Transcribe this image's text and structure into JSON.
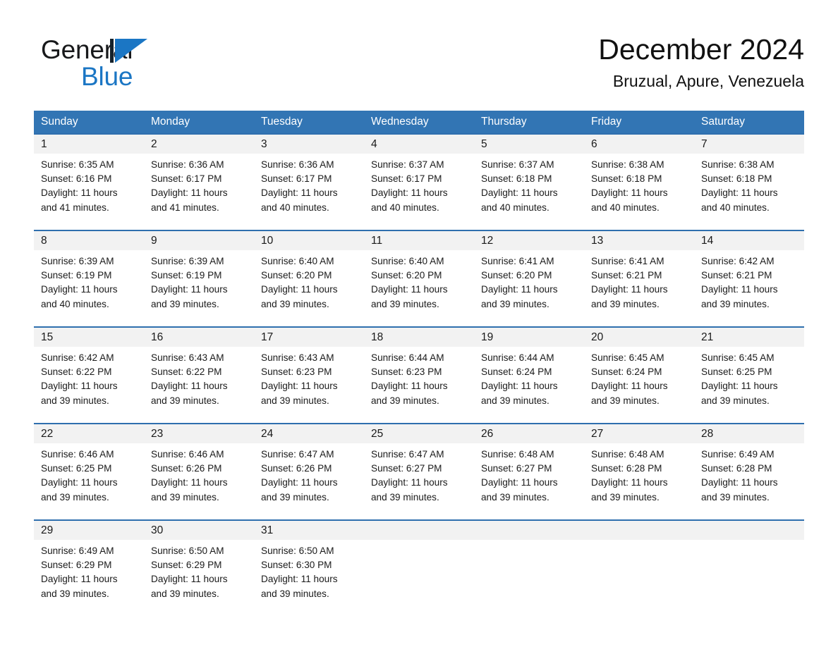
{
  "brand": {
    "word1": "General",
    "word2": "Blue",
    "mark_icon": "blue-triangle-logo-icon"
  },
  "header": {
    "title": "December 2024",
    "subtitle": "Bruzual, Apure, Venezuela"
  },
  "colors": {
    "header_blue": "#3275b4",
    "rule_blue": "#2f6fae",
    "daynum_band": "#f2f2f2",
    "brand_blue": "#1b76c4",
    "text": "#1a1a1a",
    "page_background": "#ffffff"
  },
  "weekdays": [
    "Sunday",
    "Monday",
    "Tuesday",
    "Wednesday",
    "Thursday",
    "Friday",
    "Saturday"
  ],
  "weeks": [
    {
      "days": [
        {
          "num": "1",
          "sunrise": "Sunrise: 6:35 AM",
          "sunset": "Sunset: 6:16 PM",
          "daylight1": "Daylight: 11 hours",
          "daylight2": "and 41 minutes."
        },
        {
          "num": "2",
          "sunrise": "Sunrise: 6:36 AM",
          "sunset": "Sunset: 6:17 PM",
          "daylight1": "Daylight: 11 hours",
          "daylight2": "and 41 minutes."
        },
        {
          "num": "3",
          "sunrise": "Sunrise: 6:36 AM",
          "sunset": "Sunset: 6:17 PM",
          "daylight1": "Daylight: 11 hours",
          "daylight2": "and 40 minutes."
        },
        {
          "num": "4",
          "sunrise": "Sunrise: 6:37 AM",
          "sunset": "Sunset: 6:17 PM",
          "daylight1": "Daylight: 11 hours",
          "daylight2": "and 40 minutes."
        },
        {
          "num": "5",
          "sunrise": "Sunrise: 6:37 AM",
          "sunset": "Sunset: 6:18 PM",
          "daylight1": "Daylight: 11 hours",
          "daylight2": "and 40 minutes."
        },
        {
          "num": "6",
          "sunrise": "Sunrise: 6:38 AM",
          "sunset": "Sunset: 6:18 PM",
          "daylight1": "Daylight: 11 hours",
          "daylight2": "and 40 minutes."
        },
        {
          "num": "7",
          "sunrise": "Sunrise: 6:38 AM",
          "sunset": "Sunset: 6:18 PM",
          "daylight1": "Daylight: 11 hours",
          "daylight2": "and 40 minutes."
        }
      ]
    },
    {
      "days": [
        {
          "num": "8",
          "sunrise": "Sunrise: 6:39 AM",
          "sunset": "Sunset: 6:19 PM",
          "daylight1": "Daylight: 11 hours",
          "daylight2": "and 40 minutes."
        },
        {
          "num": "9",
          "sunrise": "Sunrise: 6:39 AM",
          "sunset": "Sunset: 6:19 PM",
          "daylight1": "Daylight: 11 hours",
          "daylight2": "and 39 minutes."
        },
        {
          "num": "10",
          "sunrise": "Sunrise: 6:40 AM",
          "sunset": "Sunset: 6:20 PM",
          "daylight1": "Daylight: 11 hours",
          "daylight2": "and 39 minutes."
        },
        {
          "num": "11",
          "sunrise": "Sunrise: 6:40 AM",
          "sunset": "Sunset: 6:20 PM",
          "daylight1": "Daylight: 11 hours",
          "daylight2": "and 39 minutes."
        },
        {
          "num": "12",
          "sunrise": "Sunrise: 6:41 AM",
          "sunset": "Sunset: 6:20 PM",
          "daylight1": "Daylight: 11 hours",
          "daylight2": "and 39 minutes."
        },
        {
          "num": "13",
          "sunrise": "Sunrise: 6:41 AM",
          "sunset": "Sunset: 6:21 PM",
          "daylight1": "Daylight: 11 hours",
          "daylight2": "and 39 minutes."
        },
        {
          "num": "14",
          "sunrise": "Sunrise: 6:42 AM",
          "sunset": "Sunset: 6:21 PM",
          "daylight1": "Daylight: 11 hours",
          "daylight2": "and 39 minutes."
        }
      ]
    },
    {
      "days": [
        {
          "num": "15",
          "sunrise": "Sunrise: 6:42 AM",
          "sunset": "Sunset: 6:22 PM",
          "daylight1": "Daylight: 11 hours",
          "daylight2": "and 39 minutes."
        },
        {
          "num": "16",
          "sunrise": "Sunrise: 6:43 AM",
          "sunset": "Sunset: 6:22 PM",
          "daylight1": "Daylight: 11 hours",
          "daylight2": "and 39 minutes."
        },
        {
          "num": "17",
          "sunrise": "Sunrise: 6:43 AM",
          "sunset": "Sunset: 6:23 PM",
          "daylight1": "Daylight: 11 hours",
          "daylight2": "and 39 minutes."
        },
        {
          "num": "18",
          "sunrise": "Sunrise: 6:44 AM",
          "sunset": "Sunset: 6:23 PM",
          "daylight1": "Daylight: 11 hours",
          "daylight2": "and 39 minutes."
        },
        {
          "num": "19",
          "sunrise": "Sunrise: 6:44 AM",
          "sunset": "Sunset: 6:24 PM",
          "daylight1": "Daylight: 11 hours",
          "daylight2": "and 39 minutes."
        },
        {
          "num": "20",
          "sunrise": "Sunrise: 6:45 AM",
          "sunset": "Sunset: 6:24 PM",
          "daylight1": "Daylight: 11 hours",
          "daylight2": "and 39 minutes."
        },
        {
          "num": "21",
          "sunrise": "Sunrise: 6:45 AM",
          "sunset": "Sunset: 6:25 PM",
          "daylight1": "Daylight: 11 hours",
          "daylight2": "and 39 minutes."
        }
      ]
    },
    {
      "days": [
        {
          "num": "22",
          "sunrise": "Sunrise: 6:46 AM",
          "sunset": "Sunset: 6:25 PM",
          "daylight1": "Daylight: 11 hours",
          "daylight2": "and 39 minutes."
        },
        {
          "num": "23",
          "sunrise": "Sunrise: 6:46 AM",
          "sunset": "Sunset: 6:26 PM",
          "daylight1": "Daylight: 11 hours",
          "daylight2": "and 39 minutes."
        },
        {
          "num": "24",
          "sunrise": "Sunrise: 6:47 AM",
          "sunset": "Sunset: 6:26 PM",
          "daylight1": "Daylight: 11 hours",
          "daylight2": "and 39 minutes."
        },
        {
          "num": "25",
          "sunrise": "Sunrise: 6:47 AM",
          "sunset": "Sunset: 6:27 PM",
          "daylight1": "Daylight: 11 hours",
          "daylight2": "and 39 minutes."
        },
        {
          "num": "26",
          "sunrise": "Sunrise: 6:48 AM",
          "sunset": "Sunset: 6:27 PM",
          "daylight1": "Daylight: 11 hours",
          "daylight2": "and 39 minutes."
        },
        {
          "num": "27",
          "sunrise": "Sunrise: 6:48 AM",
          "sunset": "Sunset: 6:28 PM",
          "daylight1": "Daylight: 11 hours",
          "daylight2": "and 39 minutes."
        },
        {
          "num": "28",
          "sunrise": "Sunrise: 6:49 AM",
          "sunset": "Sunset: 6:28 PM",
          "daylight1": "Daylight: 11 hours",
          "daylight2": "and 39 minutes."
        }
      ]
    },
    {
      "days": [
        {
          "num": "29",
          "sunrise": "Sunrise: 6:49 AM",
          "sunset": "Sunset: 6:29 PM",
          "daylight1": "Daylight: 11 hours",
          "daylight2": "and 39 minutes."
        },
        {
          "num": "30",
          "sunrise": "Sunrise: 6:50 AM",
          "sunset": "Sunset: 6:29 PM",
          "daylight1": "Daylight: 11 hours",
          "daylight2": "and 39 minutes."
        },
        {
          "num": "31",
          "sunrise": "Sunrise: 6:50 AM",
          "sunset": "Sunset: 6:30 PM",
          "daylight1": "Daylight: 11 hours",
          "daylight2": "and 39 minutes."
        },
        {
          "num": "",
          "sunrise": "",
          "sunset": "",
          "daylight1": "",
          "daylight2": ""
        },
        {
          "num": "",
          "sunrise": "",
          "sunset": "",
          "daylight1": "",
          "daylight2": ""
        },
        {
          "num": "",
          "sunrise": "",
          "sunset": "",
          "daylight1": "",
          "daylight2": ""
        },
        {
          "num": "",
          "sunrise": "",
          "sunset": "",
          "daylight1": "",
          "daylight2": ""
        }
      ]
    }
  ]
}
